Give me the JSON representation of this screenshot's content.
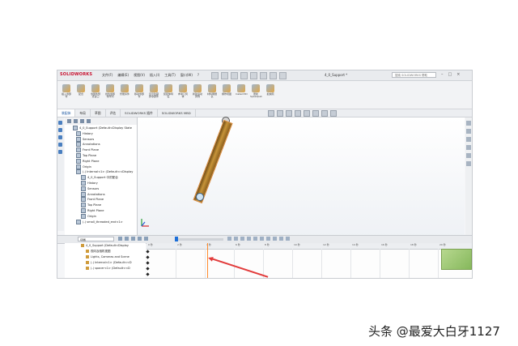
{
  "app": {
    "logo": "SOLIDWORKS",
    "menu": [
      "文件(F)",
      "编辑(E)",
      "视图(V)",
      "插入(I)",
      "工具(T)",
      "窗口(W)",
      "?"
    ],
    "doc_title": "4_0_Support *",
    "search_placeholder": "搜索 SOLIDWORKS 帮助"
  },
  "ribbon": {
    "buttons": [
      "插入零部件",
      "配合",
      "零部件预览窗口",
      "线性零部件阵列",
      "智能扣件",
      "移动零部件",
      "显示隐藏的零部件",
      "装配体特征",
      "参考几何体",
      "新建运动算例",
      "材料明细表",
      "爆炸视图",
      "Instant3D",
      "更新Speedpak",
      "拍快照"
    ]
  },
  "tabs": [
    "装配体",
    "布局",
    "草图",
    "评估",
    "SOLIDWORKS 插件",
    "SOLIDWORKS MBD"
  ],
  "feature_tree": {
    "items": [
      "4_0_Support (Default<Display State",
      "History",
      "Sensors",
      "Annotations",
      "Front Plane",
      "Top Plane",
      "Right Plane",
      "Origin",
      "(-) Internal<1> (Default<<Display",
      "4_0_Support 中的配合",
      "History",
      "Sensors",
      "Annotations",
      "Front Plane",
      "Top Plane",
      "Right Plane",
      "Origin",
      "(-) small_threaded_end<1>"
    ]
  },
  "motion": {
    "study_type": "动画",
    "tree": [
      "4_0_Support (Default<Display",
      "视向及相机视图",
      "Lights, Cameras and Scene",
      "(-) Internal<1> (Default<<D",
      "(-) spacer<1> (Default<<D"
    ],
    "ruler_ticks": [
      "0 秒",
      "2 秒",
      "4 秒",
      "6 秒",
      "8 秒",
      "10 秒",
      "12 秒",
      "14 秒",
      "16 秒",
      "18 秒",
      "20 秒"
    ]
  },
  "watermark": "头条 @最爱大白牙1127",
  "colors": {
    "accent": "#1a56a0",
    "rod": "#c79439",
    "highlight": "#d98a3a",
    "timebar": "#ff8a2b",
    "arrow": "#e23b3b"
  }
}
